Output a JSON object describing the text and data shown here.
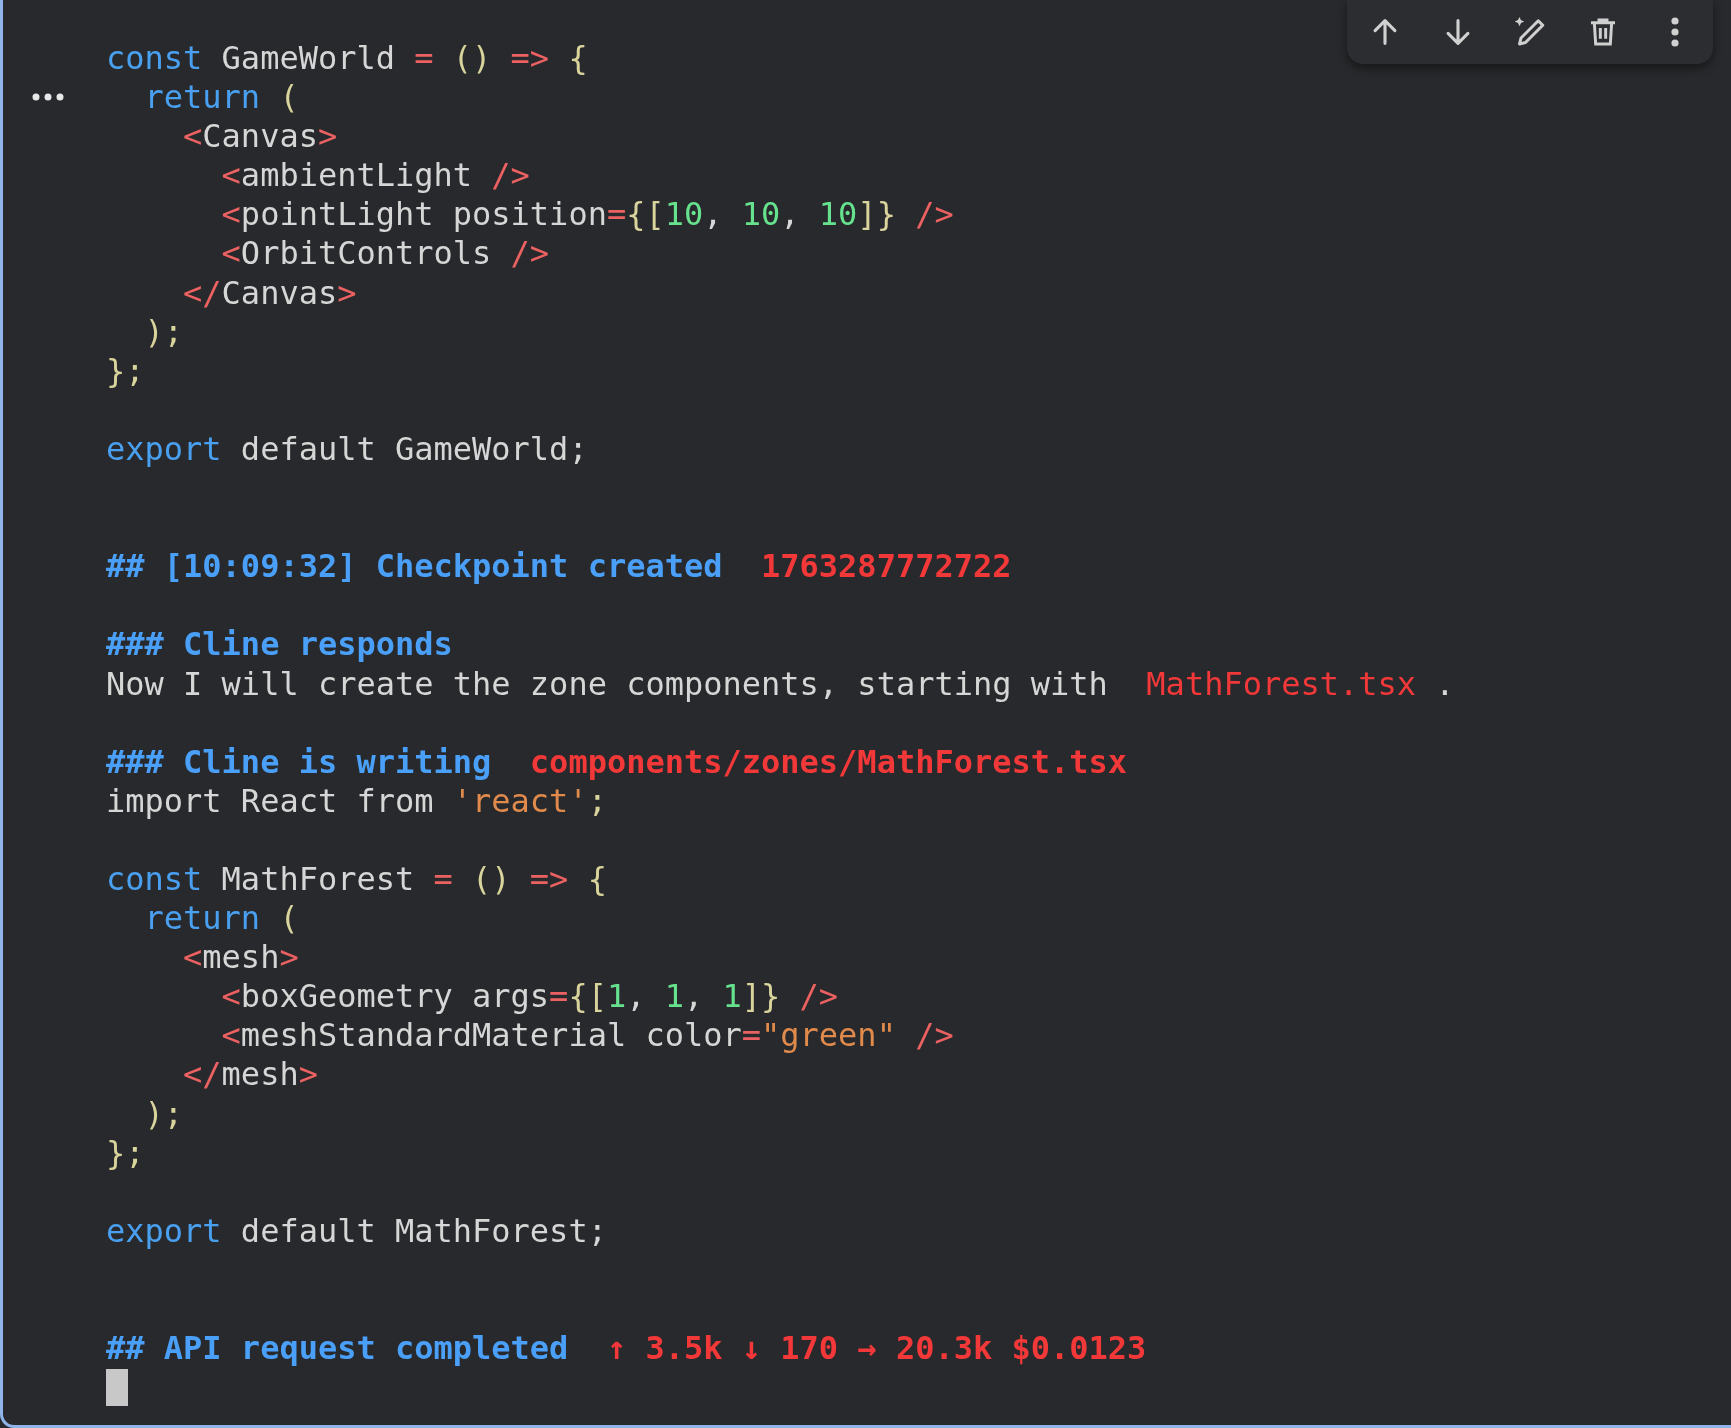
{
  "lines": [
    {
      "kind": "code",
      "tokens": [
        {
          "kind": "keyword",
          "text": "const"
        },
        {
          "kind": "plain",
          "text": " GameWorld "
        },
        {
          "kind": "punct",
          "text": "="
        },
        {
          "kind": "paren",
          "text": " () "
        },
        {
          "kind": "punct",
          "text": "=>"
        },
        {
          "kind": "paren",
          "text": " {"
        }
      ]
    },
    {
      "kind": "code",
      "tokens": [
        {
          "kind": "keyword",
          "text": "  return"
        },
        {
          "kind": "paren",
          "text": " ("
        }
      ]
    },
    {
      "kind": "code",
      "tokens": [
        {
          "kind": "punct",
          "text": "    <"
        },
        {
          "kind": "plain",
          "text": "Canvas"
        },
        {
          "kind": "punct",
          "text": ">"
        }
      ]
    },
    {
      "kind": "code",
      "tokens": [
        {
          "kind": "punct",
          "text": "      <"
        },
        {
          "kind": "plain",
          "text": "ambientLight "
        },
        {
          "kind": "punct",
          "text": "/>"
        }
      ]
    },
    {
      "kind": "code",
      "tokens": [
        {
          "kind": "punct",
          "text": "      <"
        },
        {
          "kind": "plain",
          "text": "pointLight position"
        },
        {
          "kind": "punct",
          "text": "="
        },
        {
          "kind": "paren",
          "text": "{["
        },
        {
          "kind": "number",
          "text": "10"
        },
        {
          "kind": "plain",
          "text": ", "
        },
        {
          "kind": "number",
          "text": "10"
        },
        {
          "kind": "plain",
          "text": ", "
        },
        {
          "kind": "number",
          "text": "10"
        },
        {
          "kind": "paren",
          "text": "]} "
        },
        {
          "kind": "punct",
          "text": "/>"
        }
      ]
    },
    {
      "kind": "code",
      "tokens": [
        {
          "kind": "punct",
          "text": "      <"
        },
        {
          "kind": "plain",
          "text": "OrbitControls "
        },
        {
          "kind": "punct",
          "text": "/>"
        }
      ]
    },
    {
      "kind": "code",
      "tokens": [
        {
          "kind": "punct",
          "text": "    </"
        },
        {
          "kind": "plain",
          "text": "Canvas"
        },
        {
          "kind": "punct",
          "text": ">"
        }
      ]
    },
    {
      "kind": "code",
      "tokens": [
        {
          "kind": "paren",
          "text": "  );"
        }
      ]
    },
    {
      "kind": "code",
      "tokens": [
        {
          "kind": "paren",
          "text": "};"
        }
      ]
    },
    {
      "kind": "blank"
    },
    {
      "kind": "code",
      "tokens": [
        {
          "kind": "keyword",
          "text": "export"
        },
        {
          "kind": "plain",
          "text": " default GameWorld;"
        }
      ]
    },
    {
      "kind": "blank"
    },
    {
      "kind": "blank"
    },
    {
      "kind": "heading",
      "tokens": [
        {
          "kind": "heading",
          "text": "## [10:09:32] Checkpoint created  "
        },
        {
          "kind": "accent",
          "text": "1763287772722"
        }
      ]
    },
    {
      "kind": "blank"
    },
    {
      "kind": "heading",
      "tokens": [
        {
          "kind": "heading",
          "text": "### Cline responds"
        }
      ]
    },
    {
      "kind": "text",
      "tokens": [
        {
          "kind": "plain",
          "text": "Now I will create the zone components, starting with  "
        },
        {
          "kind": "inline",
          "text": "MathForest.tsx"
        },
        {
          "kind": "plain",
          "text": " ."
        }
      ]
    },
    {
      "kind": "blank"
    },
    {
      "kind": "heading",
      "tokens": [
        {
          "kind": "heading",
          "text": "### Cline is writing  "
        },
        {
          "kind": "accent",
          "text": "components/zones/MathForest.tsx"
        }
      ]
    },
    {
      "kind": "code",
      "tokens": [
        {
          "kind": "plain",
          "text": "import React from "
        },
        {
          "kind": "string",
          "text": "'react'"
        },
        {
          "kind": "paren",
          "text": ";"
        }
      ]
    },
    {
      "kind": "blank"
    },
    {
      "kind": "code",
      "tokens": [
        {
          "kind": "keyword",
          "text": "const"
        },
        {
          "kind": "plain",
          "text": " MathForest "
        },
        {
          "kind": "punct",
          "text": "="
        },
        {
          "kind": "paren",
          "text": " () "
        },
        {
          "kind": "punct",
          "text": "=>"
        },
        {
          "kind": "paren",
          "text": " {"
        }
      ]
    },
    {
      "kind": "code",
      "tokens": [
        {
          "kind": "keyword",
          "text": "  return"
        },
        {
          "kind": "paren",
          "text": " ("
        }
      ]
    },
    {
      "kind": "code",
      "tokens": [
        {
          "kind": "punct",
          "text": "    <"
        },
        {
          "kind": "plain",
          "text": "mesh"
        },
        {
          "kind": "punct",
          "text": ">"
        }
      ]
    },
    {
      "kind": "code",
      "tokens": [
        {
          "kind": "punct",
          "text": "      <"
        },
        {
          "kind": "plain",
          "text": "boxGeometry args"
        },
        {
          "kind": "punct",
          "text": "="
        },
        {
          "kind": "paren",
          "text": "{["
        },
        {
          "kind": "number",
          "text": "1"
        },
        {
          "kind": "plain",
          "text": ", "
        },
        {
          "kind": "number",
          "text": "1"
        },
        {
          "kind": "plain",
          "text": ", "
        },
        {
          "kind": "number",
          "text": "1"
        },
        {
          "kind": "paren",
          "text": "]} "
        },
        {
          "kind": "punct",
          "text": "/>"
        }
      ]
    },
    {
      "kind": "code",
      "tokens": [
        {
          "kind": "punct",
          "text": "      <"
        },
        {
          "kind": "plain",
          "text": "meshStandardMaterial color"
        },
        {
          "kind": "punct",
          "text": "="
        },
        {
          "kind": "string",
          "text": "\"green\""
        },
        {
          "kind": "punct",
          "text": " />"
        }
      ]
    },
    {
      "kind": "code",
      "tokens": [
        {
          "kind": "punct",
          "text": "    </"
        },
        {
          "kind": "plain",
          "text": "mesh"
        },
        {
          "kind": "punct",
          "text": ">"
        }
      ]
    },
    {
      "kind": "code",
      "tokens": [
        {
          "kind": "paren",
          "text": "  );"
        }
      ]
    },
    {
      "kind": "code",
      "tokens": [
        {
          "kind": "paren",
          "text": "};"
        }
      ]
    },
    {
      "kind": "blank"
    },
    {
      "kind": "code",
      "tokens": [
        {
          "kind": "keyword",
          "text": "export"
        },
        {
          "kind": "plain",
          "text": " default MathForest;"
        }
      ]
    },
    {
      "kind": "blank"
    },
    {
      "kind": "blank"
    },
    {
      "kind": "heading",
      "tokens": [
        {
          "kind": "heading",
          "text": "## API request completed  "
        },
        {
          "kind": "accent",
          "text": "↑ 3.5k ↓ 170 → 20.3k $0.0123"
        }
      ]
    }
  ]
}
